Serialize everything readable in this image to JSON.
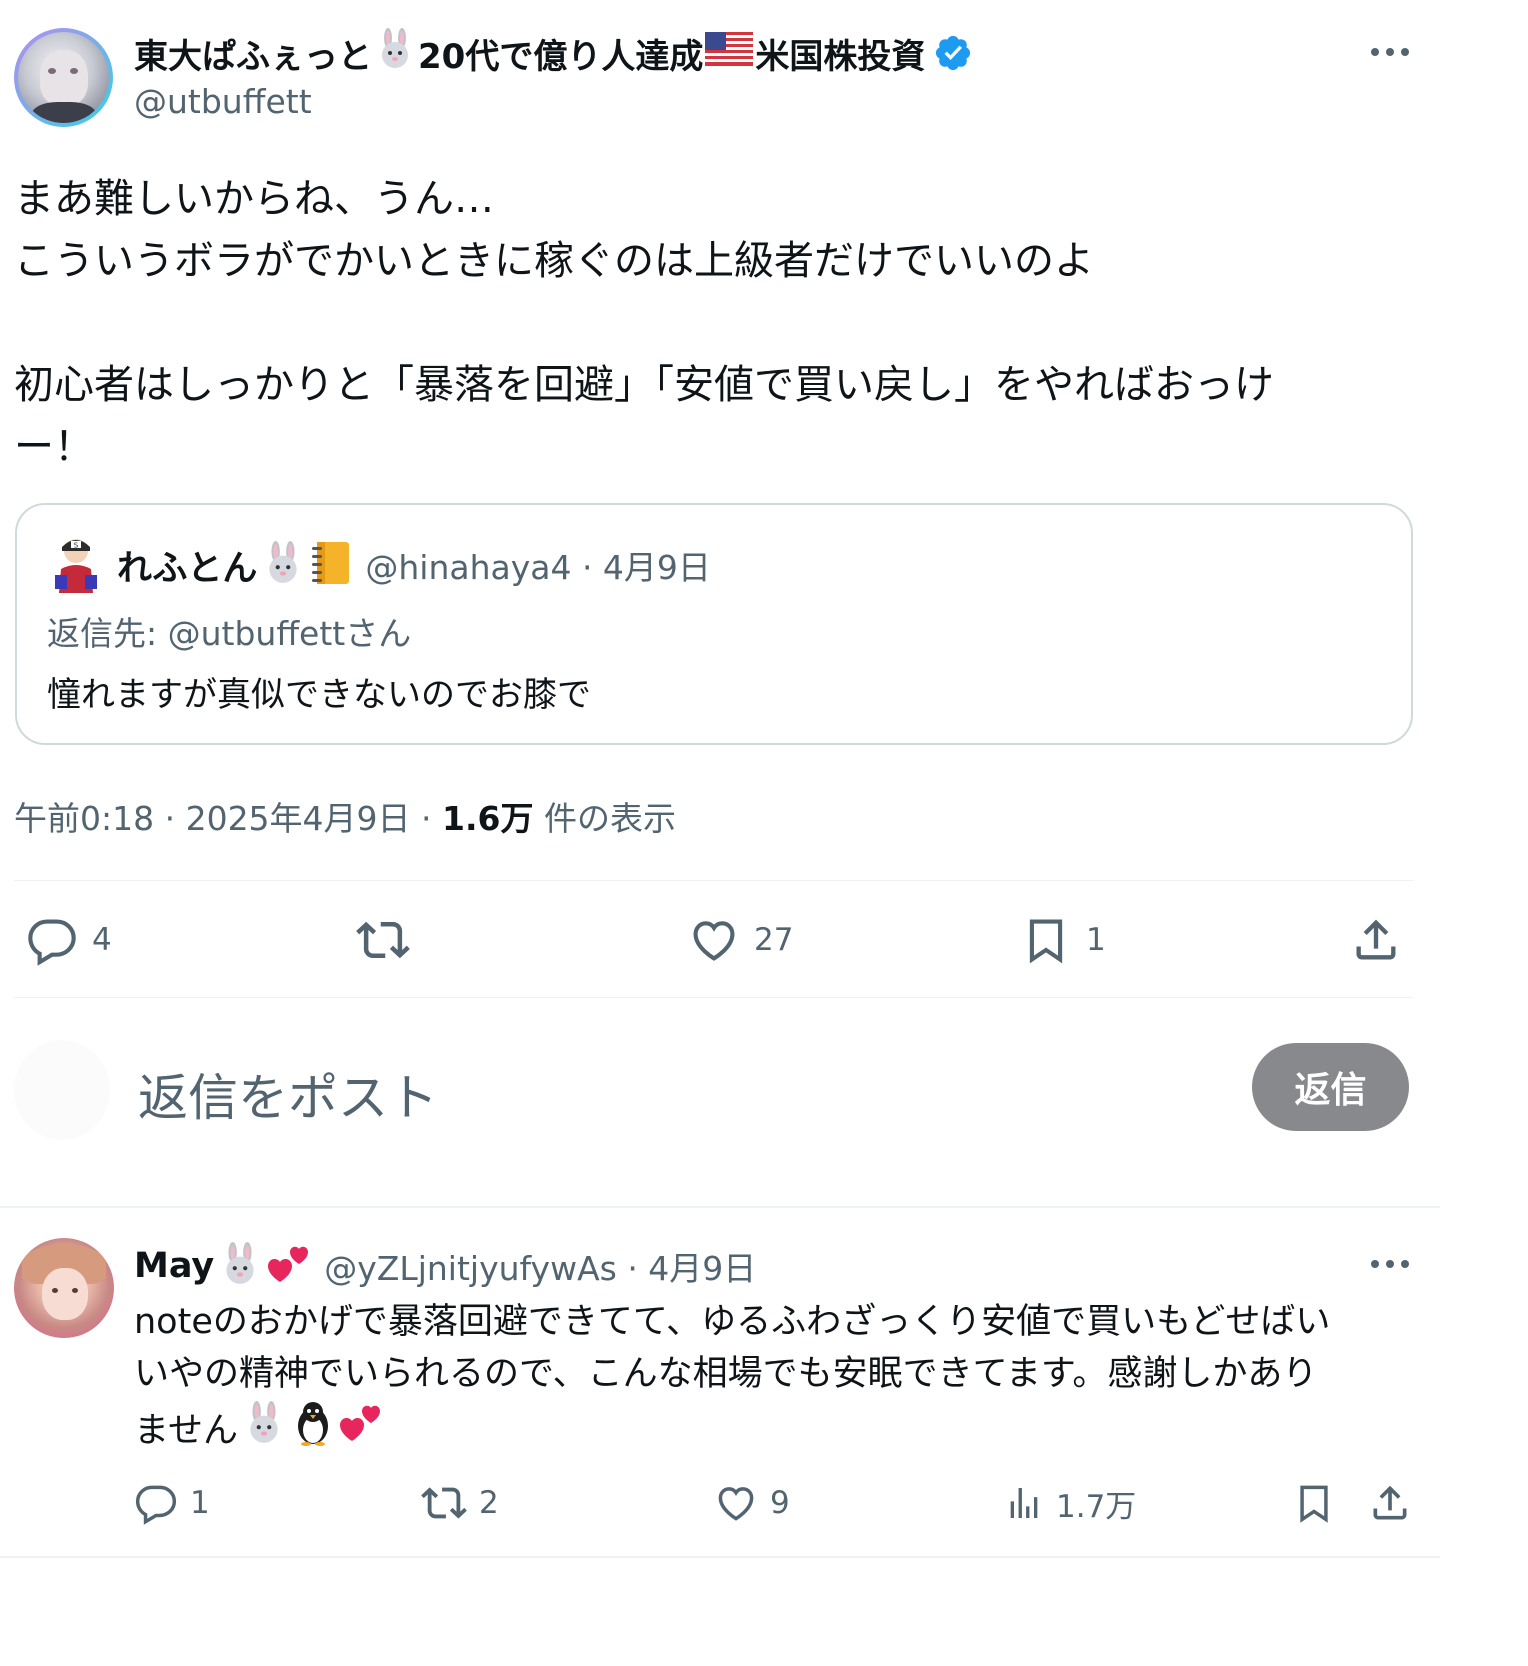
{
  "tweet": {
    "author_name": "東大ぱふぇっと",
    "author_name_rest": "20代で億り人達成",
    "author_name_tail": "米国株投資",
    "author_handle": "@utbuffett",
    "verified": true,
    "text_line1": "まあ難しいからね、うん…",
    "text_line2": "こういうボラがでかいときに稼ぐのは上級者だけでいいのよ",
    "text_line3": "初心者はしっかりと「暴落を回避」「安値で買い戻し」をやればおっけ",
    "text_line4": "ー！",
    "more_icon": "more-horizontal-icon",
    "timestamp": "午前0:18 · 2025年4月9日 · ",
    "views_count": "1.6万",
    "views_label": " 件の表示"
  },
  "quote": {
    "name": "れふとん",
    "handle_date": "@hinahaya4 · 4月9日",
    "reply_to": "返信先: @utbuffettさん",
    "text": "憧れますが真似できないのでお膝で"
  },
  "actions": {
    "replies": "4",
    "retweets": "",
    "likes": "27",
    "bookmarks": "1"
  },
  "compose": {
    "placeholder": "返信をポスト",
    "reply_button": "返信"
  },
  "reply": {
    "name": "May",
    "handle_date": "@yZLjnitjyufywAs · 4月9日",
    "text_line1": "noteのおかげで暴落回避できてて、ゆるふわざっくり安値で買いもどせばい",
    "text_line2": "いやの精神でいられるので、こんな相場でも安眠できてます。感謝しかあり",
    "text_line3": "ません",
    "actions": {
      "replies": "1",
      "retweets": "2",
      "likes": "9",
      "views": "1.7万"
    }
  },
  "colors": {
    "accent": "#1d9bf0",
    "muted": "#536471",
    "border": "#cfd9de",
    "reply_button_bg": "#87898c"
  }
}
